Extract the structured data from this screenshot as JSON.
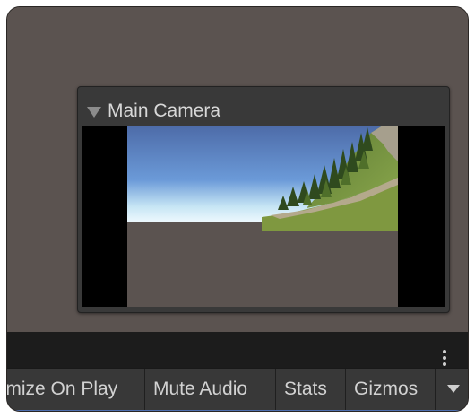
{
  "camera_preview": {
    "title": "Main Camera"
  },
  "game_toolbar": {
    "maximize_on_play": "Maximize On Play",
    "mute_audio": "Mute Audio",
    "stats": "Stats",
    "gizmos": "Gizmos"
  },
  "icons": {
    "overflow": "vertical-ellipsis-icon",
    "foldout": "triangle-down-icon",
    "gizmos_dropdown": "chevron-down-icon"
  },
  "colors": {
    "scene_background": "#5b5350",
    "panel_dark": "#1c1c1c",
    "toolbar": "#3c3c3c",
    "text": "#d2d2d2"
  }
}
